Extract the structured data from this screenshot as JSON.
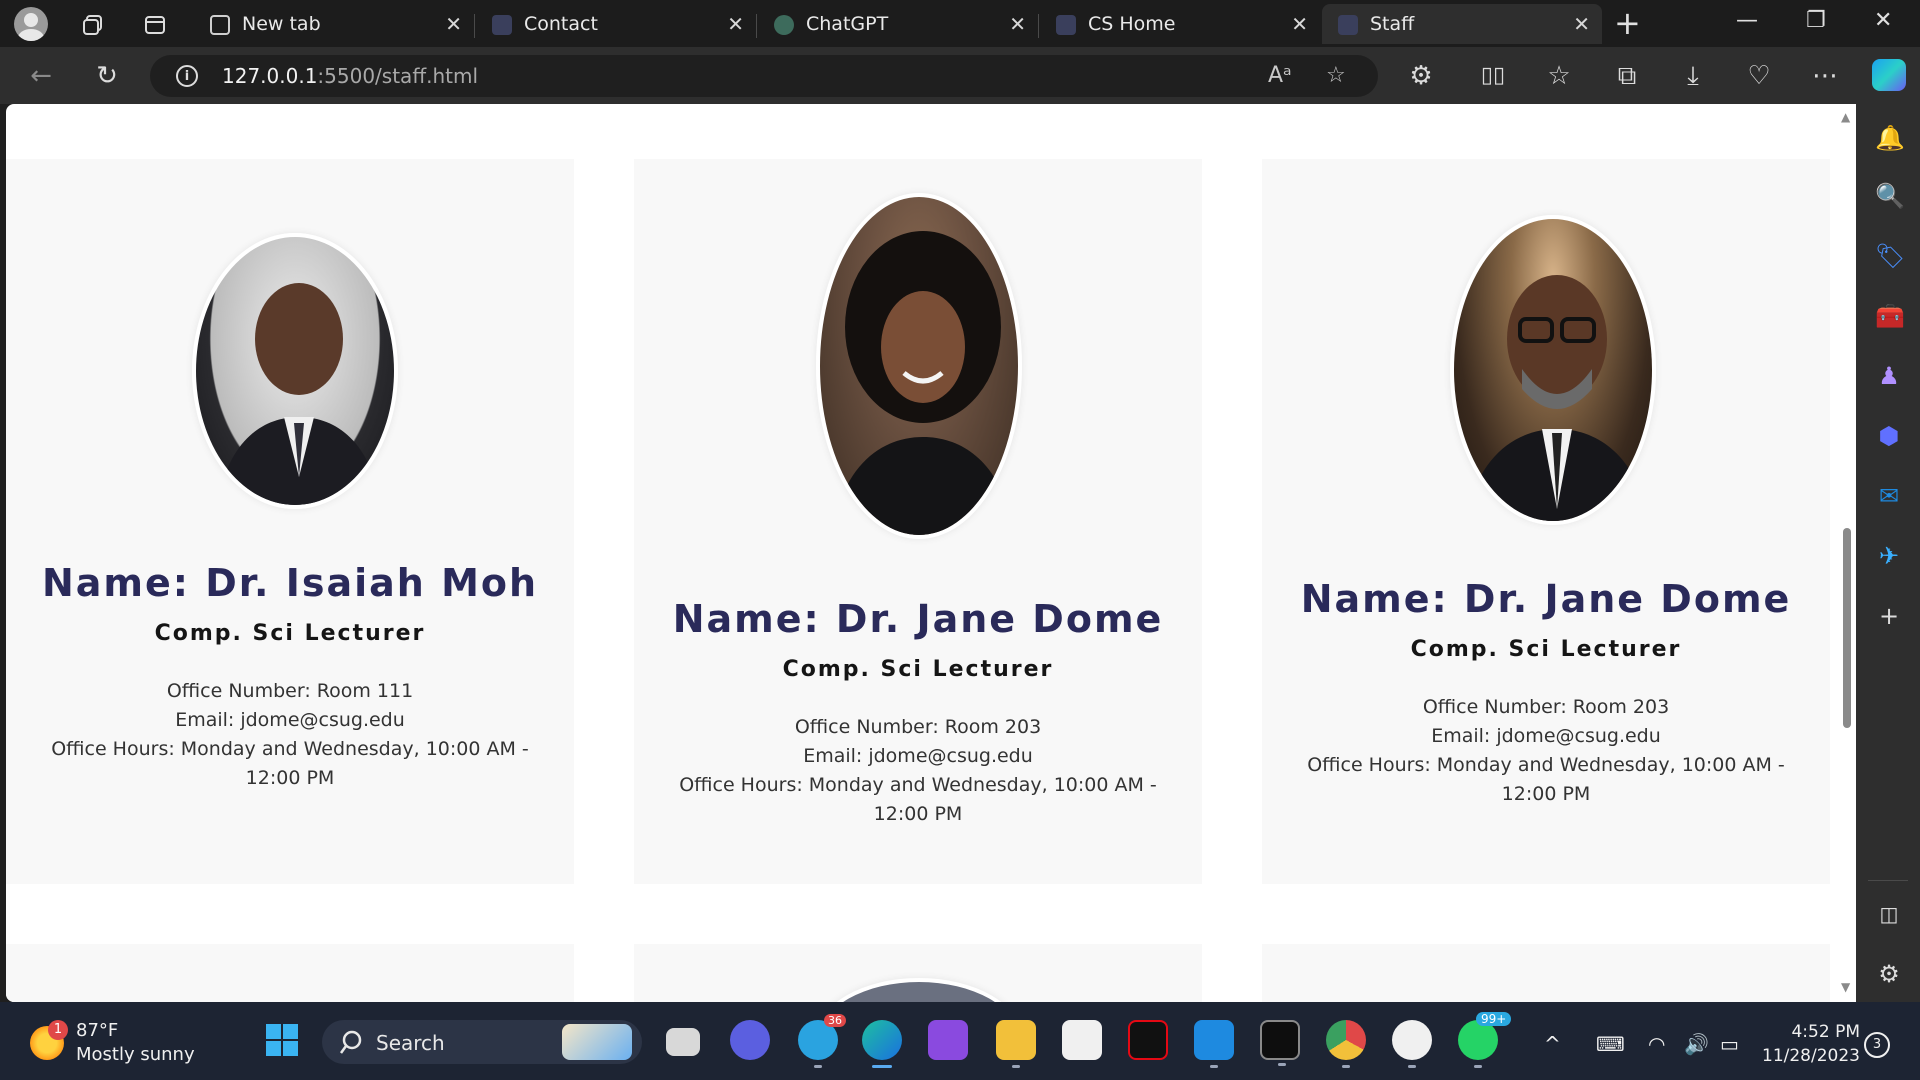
{
  "browser": {
    "tabs": [
      {
        "title": "New tab",
        "active": false
      },
      {
        "title": "Contact",
        "active": false
      },
      {
        "title": "ChatGPT",
        "active": false
      },
      {
        "title": "CS Home",
        "active": false
      },
      {
        "title": "Staff",
        "active": true
      }
    ],
    "address": {
      "host": "127.0.0.1",
      "path": ":5500/staff.html"
    }
  },
  "staff": [
    {
      "name": "Name: Dr. Isaiah Moh",
      "role": "Comp. Sci Lecturer",
      "office": "Office Number: Room 111",
      "email": "Email: jdome@csug.edu",
      "hours": "Office Hours: Monday and Wednesday, 10:00 AM - 12:00 PM"
    },
    {
      "name": "Name: Dr. Jane Dome",
      "role": "Comp. Sci Lecturer",
      "office": "Office Number: Room 203",
      "email": "Email: jdome@csug.edu",
      "hours": "Office Hours: Monday and Wednesday, 10:00 AM - 12:00 PM"
    },
    {
      "name": "Name: Dr. Jane Dome",
      "role": "Comp. Sci Lecturer",
      "office": "Office Number: Room 203",
      "email": "Email: jdome@csug.edu",
      "hours": "Office Hours: Monday and Wednesday, 10:00 AM - 12:00 PM"
    }
  ],
  "taskbar": {
    "weather_temp": "87°F",
    "weather_cond": "Mostly sunny",
    "weather_badge": "1",
    "search_label": "Search",
    "telegram_badge": "36",
    "whatsapp_badge": "99+",
    "time": "4:52 PM",
    "date": "11/28/2023",
    "notifications": "3"
  },
  "colors": {
    "name_text": "#2a2a5a",
    "card_bg": "#f8f8f8",
    "browser_chrome": "#2e2e2e"
  }
}
